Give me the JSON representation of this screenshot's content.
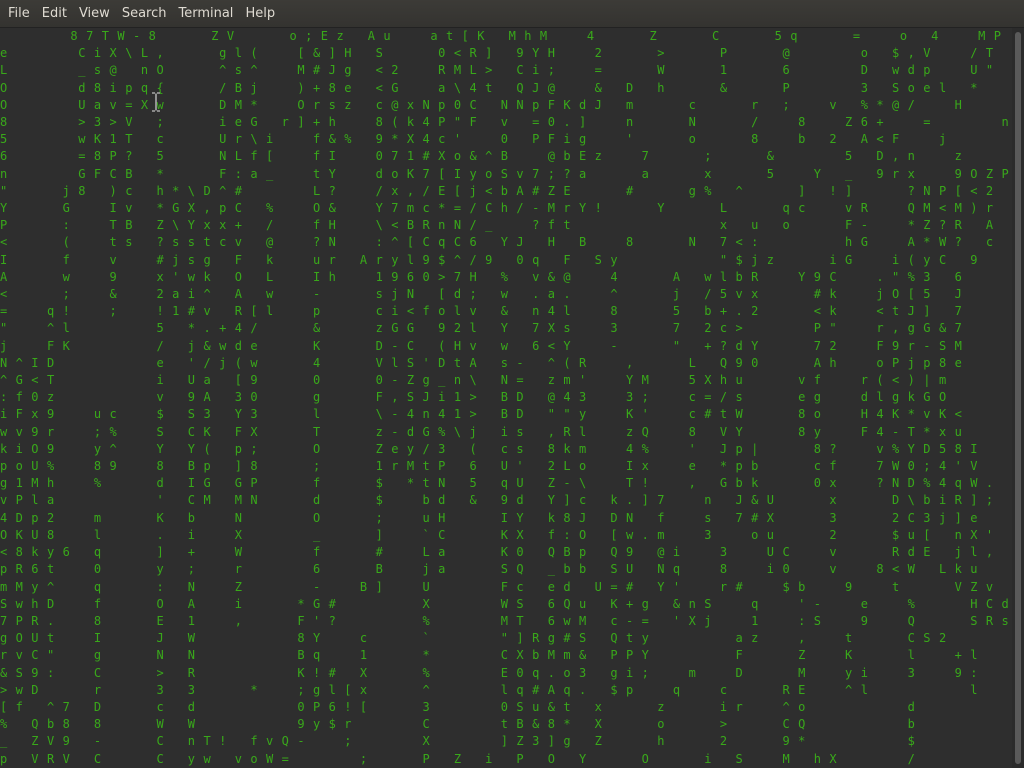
{
  "menu": {
    "items": [
      {
        "label": "File"
      },
      {
        "label": "Edit"
      },
      {
        "label": "View"
      },
      {
        "label": "Search"
      },
      {
        "label": "Terminal"
      },
      {
        "label": "Help"
      }
    ]
  },
  "terminal": {
    "rain_lines": [
      "         8 7 T W - 8       Z V       o ; E z   A u     a t [ K   M h M     4       Z       C       5 q       =     o   4     M P       q O",
      "e         C i X \\ L ,       g l (     [ & ] H   S       0 < R ]   9 Y H     2       >       P       @         o   $ , V     / T       o L",
      "L         _ s @   n O       ^ s ^     M # J g   < 2     R M L >   C i ;     =       W       1       6         D   w d p     U \"       % 7",
      "O         d 8 i p q {       / B j     ) + 8 e   < G     a \\ 4 t   Q J @     &   D   h       &       P         3   S o e l   *         & D",
      "O         U a v = X w       D M *     O r s z   c @ x N p 0 C   N N p F K d J   m       c       r   ;     v   % * @ /     H         % j Y",
      "8         > 3 > V   ;       i e G   r ] + h     8 ( k 4 P \" F   v   = 0 . ]     n       N       /     8     Z 6 +     =         n k w",
      "5         w K 1 T   c       U r \\ i     f & %   9 * X 4 c '     0   P F i g     '       o       8     b   2   A < F     j         Z x L",
      "6         = 8 P ?   5       N L f [     f I     0 7 1 # X o & ^ B     @ b E z     7       ;       &         5   D , n     z         r e ,",
      "n         G F C B   *       F : a _     t Y     d o K 7 [ I y o S v 7 ; ? a       a       x       5     Y   _   9 r x     9 O Z P ' 4",
      "\"       j 8   ) c   h * \\ D ^ #         L ?     / x , / E [ j < b A # Z E       #       g %   ^       ]   ! ]       ? N P [ < 2",
      "Y       G     I v   * G X , p C   %     O &     Y 7 m c * = / C h / - M r Y !       Y       L       q c     v R     Q M < M ) r",
      "P       :     T B   Z \\ Y x x +   /     f H     \\ < B R n N / _     ? f t                   x   u   o       F -     * Z ? R   A",
      "<       (     t s   ? s s t c v   @     ? N     : ^ [ C q C 6   Y J   H   B     8       N   7 < :           h G     A * W ?   c",
      "I       f     v     # j s g   F   k     u r   A r y l 9 $ ^ / 9   0 q   F   S y             \" $ j z       i G     i ( y C   9",
      "A       w     9     x ' w k   O   L     I h     1 9 6 0 > 7 H   %   v & @     4       A   w l b R     Y 9 C     . \" % 3   6",
      "<       ;     &     2 a i ^   A   w     -       s j N   [ d ;   w   . a .     ^       j   / 5 v x       # k     j O [ 5   J",
      "=     q !     ;     ! 1 # v   R [ l     p       c i < f o l v   &   n 4 l     8       5   b + . 2       < k     < t J ]   7",
      "\"     ^ l           5   * . + 4 /       &       z G G   9 2 l   Y   7 X s     3       7   2 c >         P \"     r , g G & 7",
      "j     F K           /   j & w d e       K       D - C   ( H v   w   6 < Y     -       \"   + ? d Y       7 2     F 9 r - S M",
      "N ^ I D             e   ' / j ( w       4       V l S ' D t A   s -   ^ ( R     ,       L   Q 9 0       A h     o P j p 8 e",
      "^ G < T             i   U a   [ 9       0       0 - Z g _ n \\   N =   z m '     Y M     5 X h u       v f     r ( < ) | m",
      ": f 0 z             v   9 A   3 0       g       F , S J i 1 >   B D   @ 4 3     3 ;     c = / s       e g     d l g k G O",
      "i F x 9     u c     $   S 3   Y 3       l       \\ - 4 n 4 1 >   B D   \" \" y     K '     c # t W       8 o     H 4 K * v K <",
      "w v 9 r     ; %     S   C K   F X       T       z - d G % \\ j   i s   , R l     z Q     8   V Y       8 y     F 4 - T * x u",
      "k i O 9     y ^     Y   Y (   p ;       O       Z e y / 3   (   c s   8 k m     4 %     '   J p |       8 ?     v % Y D 5 8 I",
      "p o U %     8 9     8   B p   ] 8       ;       1 r M t P   6   U '   2 L o     I x     e   * p b       c f     7 W 0 ; 4 ' V",
      "g 1 M h     %       d   I G   G P       f       $   * t N   5   q U   Z - \\     T !     ,   G b k       0 x     ? N D % 4 q W .",
      "v P l a             '   C M   M N       d       $     b d   &   9 d   Y ] c   k . ] 7     n   J & U       x       D \\ b i R ] ;",
      "4 D p 2     m       K   b     N         O       ;     u H       I Y   k 8 J   D N   f     s   7 # X       3       2 C 3 j ] e",
      "O K U 8     l       .   i     X         _       ]     ` C       K X   f : O   [ w . m     3     o u       2       $ u [   n X '",
      "< 8 k y 6   q       ]   +     W         f       #     L a       K 0   Q B p   Q 9   @ i     3     U C     v       R d E   j l ,",
      "p R 6 t     0       y   ;     r         6       B     j a       S Q   _ b b   S U   N q     8     i 0     v     8 < W   L k u",
      "m M y ^     q       :   N     Z         -     B ]     U         F c   e d   U = #   Y '     r #     $ b     9     t       V Z v",
      "S w h D     f       O   A     i       * G #           X         W S   6 Q u   K + g   & n S     q     ' -     e     %       H C d",
      "7 P R .     8       E   1     ,       F ' ?           %         M T   6 w M   c - =   ' X j     1     : S     9     Q       S R s",
      "g O U t     I       J   W             8 Y     c       `         \" ] R g # S   Q t y           a z     ,     t       C S 2",
      "r v C \"     g       N   N             B q     1       *         C X b M m &   P P Y           F       Z     K       l     + l",
      "& S 9 :     C       >   R             K ! #   X       %         E 0 q . o 3   g i ;     m     D       M     y i     3     9 :",
      "> w D       r       3   3       *     ; g l [ x       ^         l q # A q .   $ p     q     c       R E     ^ l             l",
      "[ f   ^ 7   D       c   d             0 P 6 ! [       3         0 S u & t   x       z       i r     ^ o             d",
      "%   Q b 8   8       W   W             9 y $ r         C         t B & 8 *   X       o       >       C Q             b",
      "_   Z V 9   -       C   n T !   f v Q -     ;         X         ] Z 3 ] g   Z       h       2       9 *             $",
      "p   V R V   C       C   y w   v o W =         ;       P   Z   i   P   O   Y       O       i   S     M   h X         /"
    ]
  },
  "colors": {
    "background": "#2e2e2e",
    "rain_text": "#39a81a",
    "menu_text": "#dfdbd2"
  },
  "icons": {
    "cursor": "ibeam-cursor-icon"
  }
}
